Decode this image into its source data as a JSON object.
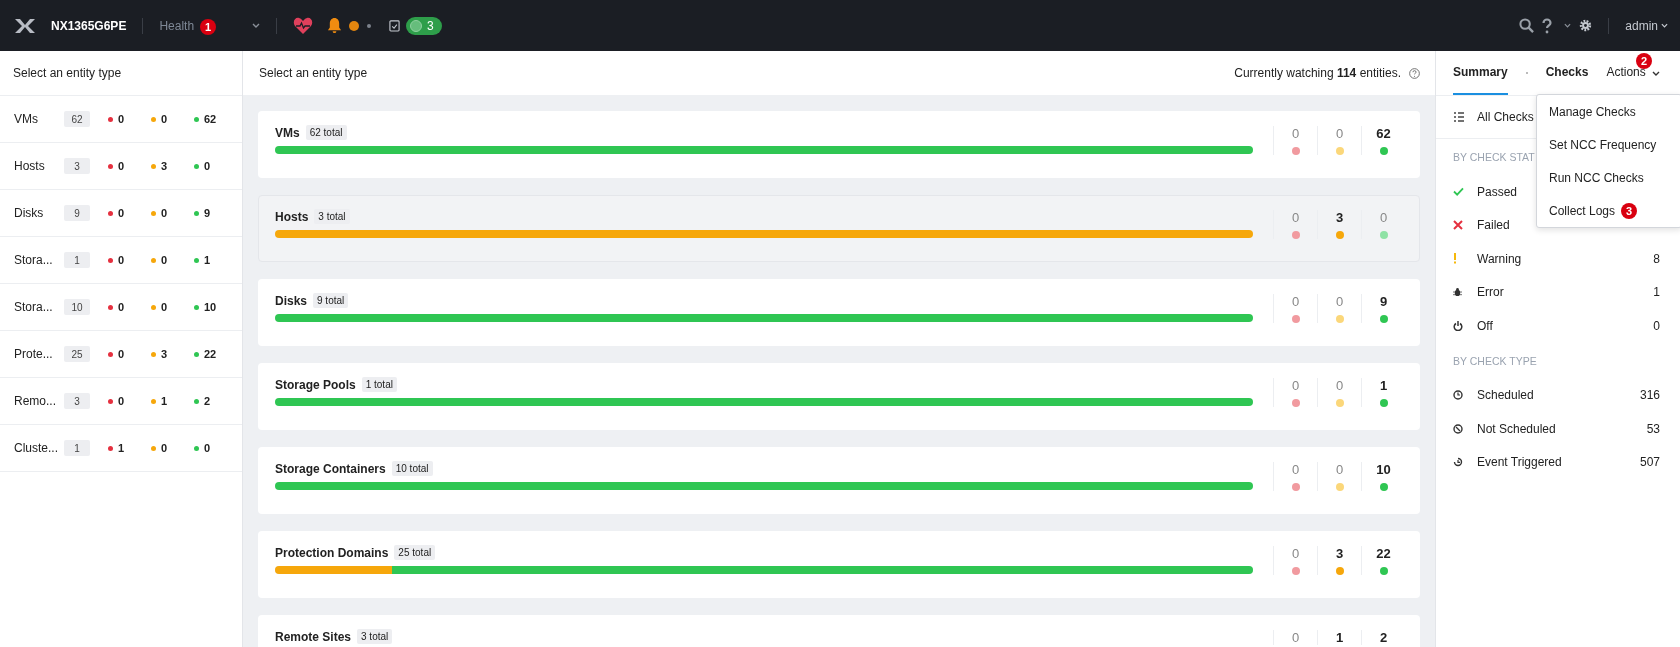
{
  "topbar": {
    "cluster": "NX1365G6PE",
    "menu": "Health",
    "menu_badge": "1",
    "pill_count": "3",
    "user": "admin"
  },
  "left": {
    "title": "Select an entity type",
    "rows": [
      {
        "name": "VMs",
        "total": "62",
        "counts": [
          {
            "kind": "critical",
            "value": "0"
          },
          {
            "kind": "warning",
            "value": "0"
          },
          {
            "kind": "ok",
            "value": "62"
          }
        ]
      },
      {
        "name": "Hosts",
        "total": "3",
        "counts": [
          {
            "kind": "critical",
            "value": "0"
          },
          {
            "kind": "warning",
            "value": "3"
          },
          {
            "kind": "ok",
            "value": "0"
          }
        ]
      },
      {
        "name": "Disks",
        "total": "9",
        "counts": [
          {
            "kind": "critical",
            "value": "0"
          },
          {
            "kind": "warning",
            "value": "0"
          },
          {
            "kind": "ok",
            "value": "9"
          }
        ]
      },
      {
        "name": "Stora...",
        "total": "1",
        "counts": [
          {
            "kind": "critical",
            "value": "0"
          },
          {
            "kind": "warning",
            "value": "0"
          },
          {
            "kind": "ok",
            "value": "1"
          }
        ]
      },
      {
        "name": "Stora...",
        "total": "10",
        "counts": [
          {
            "kind": "critical",
            "value": "0"
          },
          {
            "kind": "warning",
            "value": "0"
          },
          {
            "kind": "ok",
            "value": "10"
          }
        ]
      },
      {
        "name": "Prote...",
        "total": "25",
        "counts": [
          {
            "kind": "critical",
            "value": "0"
          },
          {
            "kind": "warning",
            "value": "3"
          },
          {
            "kind": "ok",
            "value": "22"
          }
        ]
      },
      {
        "name": "Remo...",
        "total": "3",
        "counts": [
          {
            "kind": "critical",
            "value": "0"
          },
          {
            "kind": "warning",
            "value": "1"
          },
          {
            "kind": "ok",
            "value": "2"
          }
        ]
      },
      {
        "name": "Cluste...",
        "total": "1",
        "counts": [
          {
            "kind": "critical",
            "value": "1"
          },
          {
            "kind": "warning",
            "value": "0"
          },
          {
            "kind": "ok",
            "value": "0"
          }
        ]
      }
    ]
  },
  "center": {
    "title": "Select an entity type",
    "watching": "Currently watching **114** entities.",
    "cards": [
      {
        "name": "VMs",
        "total": "62 total",
        "selected": false,
        "bar": [
          {
            "kind": "ok",
            "level": 1
          }
        ],
        "counts": [
          {
            "kind": "critical",
            "value": "0",
            "active": false
          },
          {
            "kind": "warning",
            "value": "0",
            "active": false
          },
          {
            "kind": "ok",
            "value": "62",
            "active": true
          }
        ]
      },
      {
        "name": "Hosts",
        "total": "3 total",
        "selected": true,
        "bar": [
          {
            "kind": "warning",
            "level": 1
          }
        ],
        "counts": [
          {
            "kind": "critical",
            "value": "0",
            "active": false
          },
          {
            "kind": "warning",
            "value": "3",
            "active": true
          },
          {
            "kind": "ok",
            "value": "0",
            "active": false
          }
        ]
      },
      {
        "name": "Disks",
        "total": "9 total",
        "selected": false,
        "bar": [
          {
            "kind": "ok",
            "level": 1
          }
        ],
        "counts": [
          {
            "kind": "critical",
            "value": "0",
            "active": false
          },
          {
            "kind": "warning",
            "value": "0",
            "active": false
          },
          {
            "kind": "ok",
            "value": "9",
            "active": true
          }
        ]
      },
      {
        "name": "Storage Pools",
        "total": "1 total",
        "selected": false,
        "bar": [
          {
            "kind": "ok",
            "level": 1
          }
        ],
        "counts": [
          {
            "kind": "critical",
            "value": "0",
            "active": false
          },
          {
            "kind": "warning",
            "value": "0",
            "active": false
          },
          {
            "kind": "ok",
            "value": "1",
            "active": true
          }
        ]
      },
      {
        "name": "Storage Containers",
        "total": "10 total",
        "selected": false,
        "bar": [
          {
            "kind": "ok",
            "level": 1
          }
        ],
        "counts": [
          {
            "kind": "critical",
            "value": "0",
            "active": false
          },
          {
            "kind": "warning",
            "value": "0",
            "active": false
          },
          {
            "kind": "ok",
            "value": "10",
            "active": true
          }
        ]
      },
      {
        "name": "Protection Domains",
        "total": "25 total",
        "selected": false,
        "bar": [
          {
            "kind": "warning",
            "level": 0.12
          },
          {
            "kind": "ok",
            "level": 0.88
          }
        ],
        "counts": [
          {
            "kind": "critical",
            "value": "0",
            "active": false
          },
          {
            "kind": "warning",
            "value": "3",
            "active": true
          },
          {
            "kind": "ok",
            "value": "22",
            "active": true
          }
        ]
      },
      {
        "name": "Remote Sites",
        "total": "3 total",
        "selected": false,
        "counts": [
          {
            "value": "0",
            "active": false
          },
          {
            "value": "1",
            "active": true
          },
          {
            "value": "2",
            "active": true
          }
        ]
      }
    ]
  },
  "right": {
    "tabs": [
      {
        "label": "Summary",
        "selected": true
      },
      {
        "label": "Checks",
        "selected": false
      },
      {
        "label": "Actions",
        "selected": false
      }
    ],
    "actions_badge": "2",
    "all_checks": "All Checks",
    "sections": [
      {
        "heading": "BY CHECK STAT",
        "items": [
          {
            "kind": "passed",
            "label": "Passed"
          },
          {
            "kind": "failed",
            "label": "Failed"
          },
          {
            "kind": "warning",
            "label": "Warning",
            "count": "8"
          },
          {
            "kind": "error",
            "label": "Error",
            "count": "1"
          },
          {
            "kind": "off",
            "label": "Off",
            "count": "0"
          }
        ]
      },
      {
        "heading": "BY CHECK TYPE",
        "items": [
          {
            "kind": "scheduled",
            "label": "Scheduled",
            "count": "316"
          },
          {
            "kind": "not_scheduled",
            "label": "Not Scheduled",
            "count": "53"
          },
          {
            "kind": "event",
            "label": "Event Triggered",
            "count": "507"
          }
        ]
      }
    ],
    "menu": [
      {
        "label": "Manage Checks"
      },
      {
        "label": "Set NCC Frequency"
      },
      {
        "label": "Run NCC Checks"
      },
      {
        "label": "Collect Logs",
        "badge": "3"
      }
    ]
  }
}
